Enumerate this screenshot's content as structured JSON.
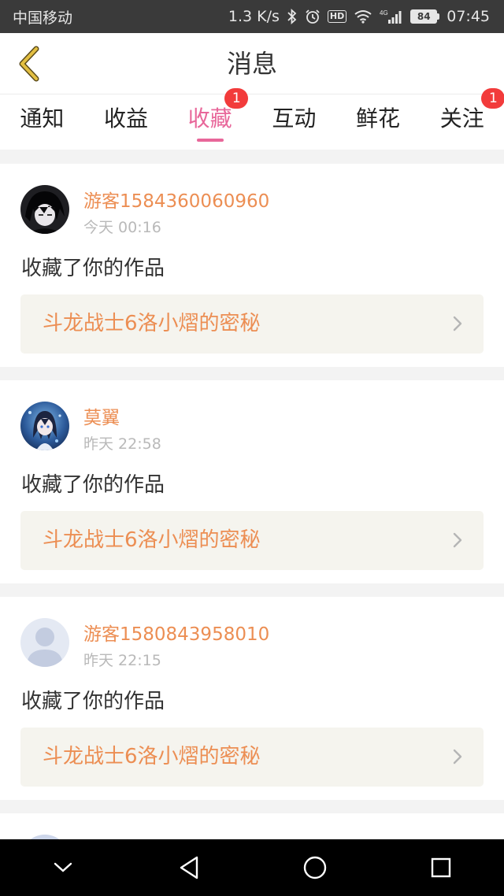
{
  "status_bar": {
    "carrier": "中国移动",
    "net_speed": "1.3 K/s",
    "hd": "HD",
    "network": "4G",
    "battery": "84",
    "time": "07:45"
  },
  "header": {
    "title": "消息"
  },
  "tabs": [
    {
      "label": "通知",
      "badge": null,
      "active": false
    },
    {
      "label": "收益",
      "badge": null,
      "active": false
    },
    {
      "label": "收藏",
      "badge": "1",
      "active": true
    },
    {
      "label": "互动",
      "badge": null,
      "active": false
    },
    {
      "label": "鲜花",
      "badge": null,
      "active": false
    },
    {
      "label": "关注",
      "badge": "1",
      "active": false
    }
  ],
  "messages": [
    {
      "username": "游客1584360060960",
      "time": "今天 00:16",
      "action": "收藏了你的作品",
      "work_title": "斗龙战士6洛小熠的密秘",
      "avatar": "dark-anime-avatar"
    },
    {
      "username": "莫翼",
      "time": "昨天 22:58",
      "action": "收藏了你的作品",
      "work_title": "斗龙战士6洛小熠的密秘",
      "avatar": "blue-anime-avatar"
    },
    {
      "username": "游客1580843958010",
      "time": "昨天 22:15",
      "action": "收藏了你的作品",
      "work_title": "斗龙战士6洛小熠的密秘",
      "avatar": "default-avatar"
    }
  ],
  "colors": {
    "accent_pink": "#e8679a",
    "accent_orange": "#ec8e53",
    "badge_red": "#f23b3b",
    "back_arrow": "#d9b43a"
  }
}
